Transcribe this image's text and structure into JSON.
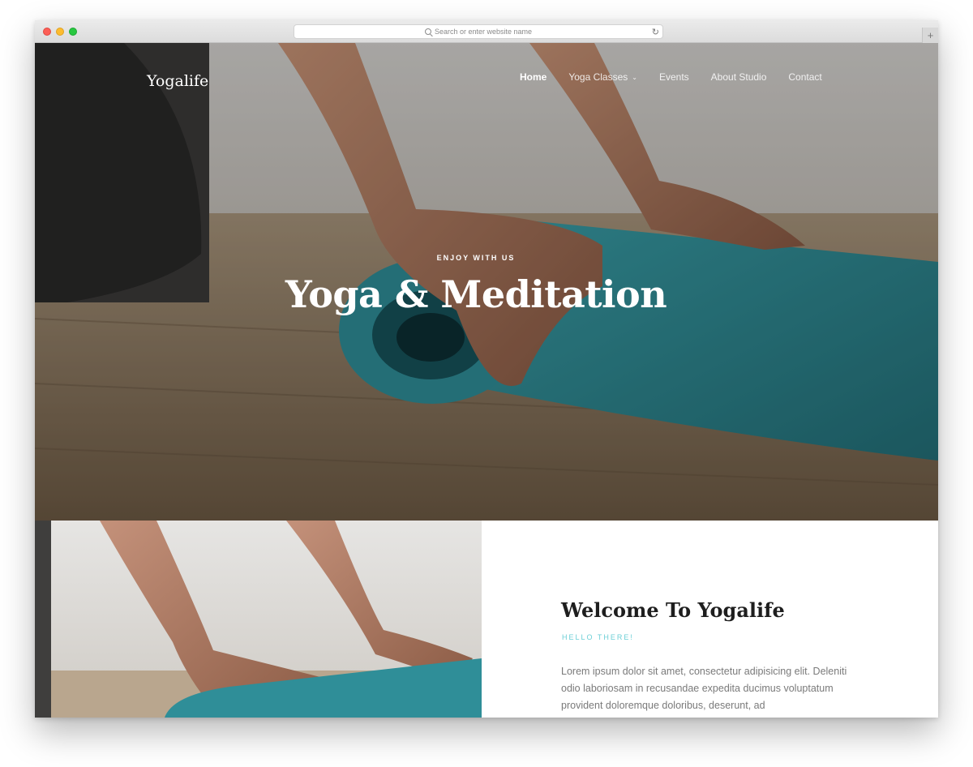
{
  "browser": {
    "address_placeholder": "Search or enter website name",
    "new_tab_icon": "+"
  },
  "site": {
    "brand": "Yogalife",
    "nav": [
      {
        "label": "Home",
        "active": true
      },
      {
        "label": "Yoga Classes",
        "has_dropdown": true
      },
      {
        "label": "Events"
      },
      {
        "label": "About Studio"
      },
      {
        "label": "Contact"
      }
    ]
  },
  "hero": {
    "eyebrow": "ENJOY WITH US",
    "title": "Yoga & Meditation"
  },
  "welcome": {
    "title": "Welcome To Yogalife",
    "eyebrow": "HELLO THERE!",
    "text": "Lorem ipsum dolor sit amet, consectetur adipisicing elit. Deleniti odio laboriosam in recusandae expedita ducimus voluptatum provident doloremque doloribus, deserunt, ad"
  },
  "colors": {
    "accent_teal": "#6ccfd6",
    "mat_teal": "#2f8e98"
  },
  "icons": {
    "search": "search-icon",
    "reload": "reload-icon",
    "dropdown": "chevron-down-icon"
  }
}
